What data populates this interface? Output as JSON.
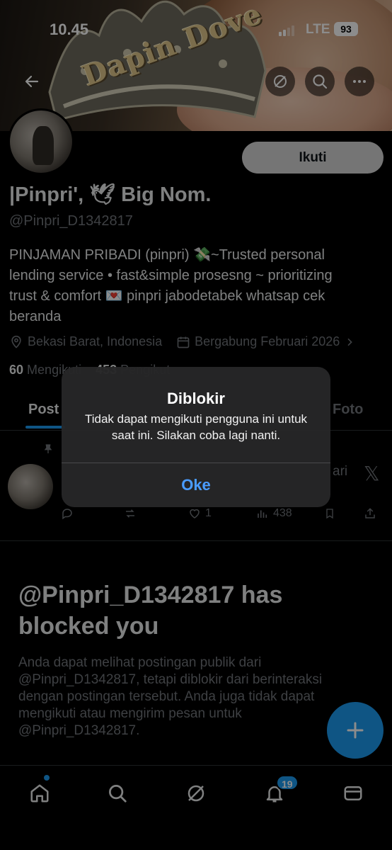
{
  "status_bar": {
    "time": "10.45",
    "network": "LTE",
    "battery": "93"
  },
  "banner": {
    "text": "Dapin Dove"
  },
  "profile": {
    "follow_label": "Ikuti",
    "name": "|Pinpri', 🕊 Big Nom.",
    "handle": "@Pinpri_D1342817",
    "bio": "PINJAMAN PRIBADI (pinpri) 💸~Trusted personal lending service • fast&simple prosesng ~ prioritizing trust & comfort 💌 pinpri jabodetabek whatsap cek beranda",
    "location": "Bekasi Barat, Indonesia",
    "joined": "Bergabung Februari 2026",
    "following_count": "60",
    "following_label": "Mengikuti",
    "followers_count": "453",
    "followers_label": "Pengikut"
  },
  "tabs": {
    "posts": "Post",
    "photos": "Foto"
  },
  "post": {
    "side_text": "ari",
    "reply_count": "",
    "like_count": "1",
    "view_count": "438"
  },
  "blocked": {
    "title": "@Pinpri_D1342817 has blocked you",
    "text": "Anda dapat melihat postingan publik dari @Pinpri_D1342817, tetapi diblokir dari berinteraksi dengan postingan tersebut. Anda juga tidak dapat mengikuti atau mengirim pesan untuk @Pinpri_D1342817."
  },
  "bottom_nav": {
    "notification_badge": "19"
  },
  "alert": {
    "title": "Diblokir",
    "message": "Tidak dapat mengikuti pengguna ini untuk saat ini. Silakan coba lagi nanti.",
    "ok_label": "Oke"
  },
  "colors": {
    "accent": "#1d9bf0",
    "alert_button": "#4a9cff",
    "muted": "#71767b"
  }
}
